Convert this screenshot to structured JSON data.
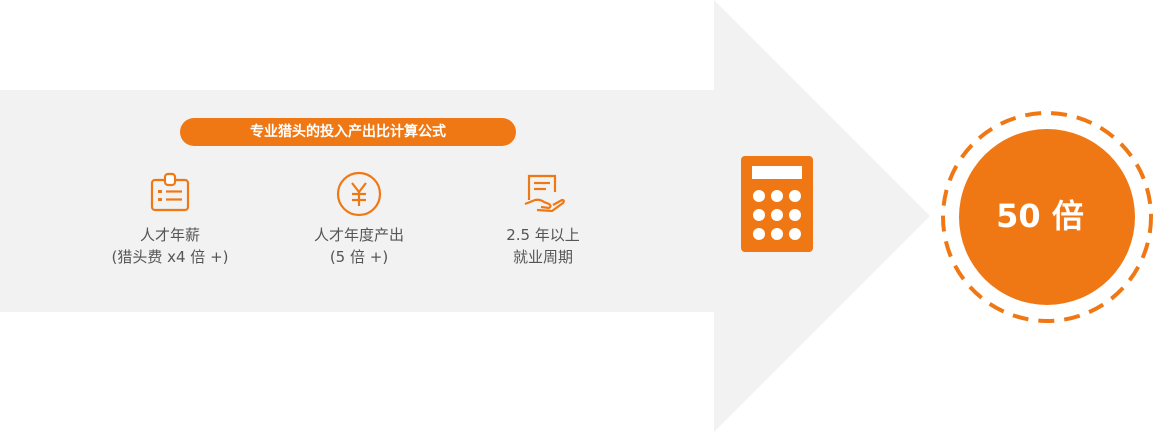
{
  "title": "专业猎头的投入产出比计算公式",
  "factors": [
    {
      "icon": "id-badge-icon",
      "line1": "人才年薪",
      "line2": "(猎头费 x4 倍 +)"
    },
    {
      "icon": "yuan-coin-icon",
      "line1": "人才年度产出",
      "line2": "(5 倍 +)"
    },
    {
      "icon": "document-hand-icon",
      "line1": "2.5 年以上",
      "line2": "就业周期"
    }
  ],
  "calculator_icon": "calculator-icon",
  "result": "50 倍",
  "colors": {
    "accent": "#f07814",
    "arrow": "#f2f2f2",
    "text": "#555555"
  }
}
